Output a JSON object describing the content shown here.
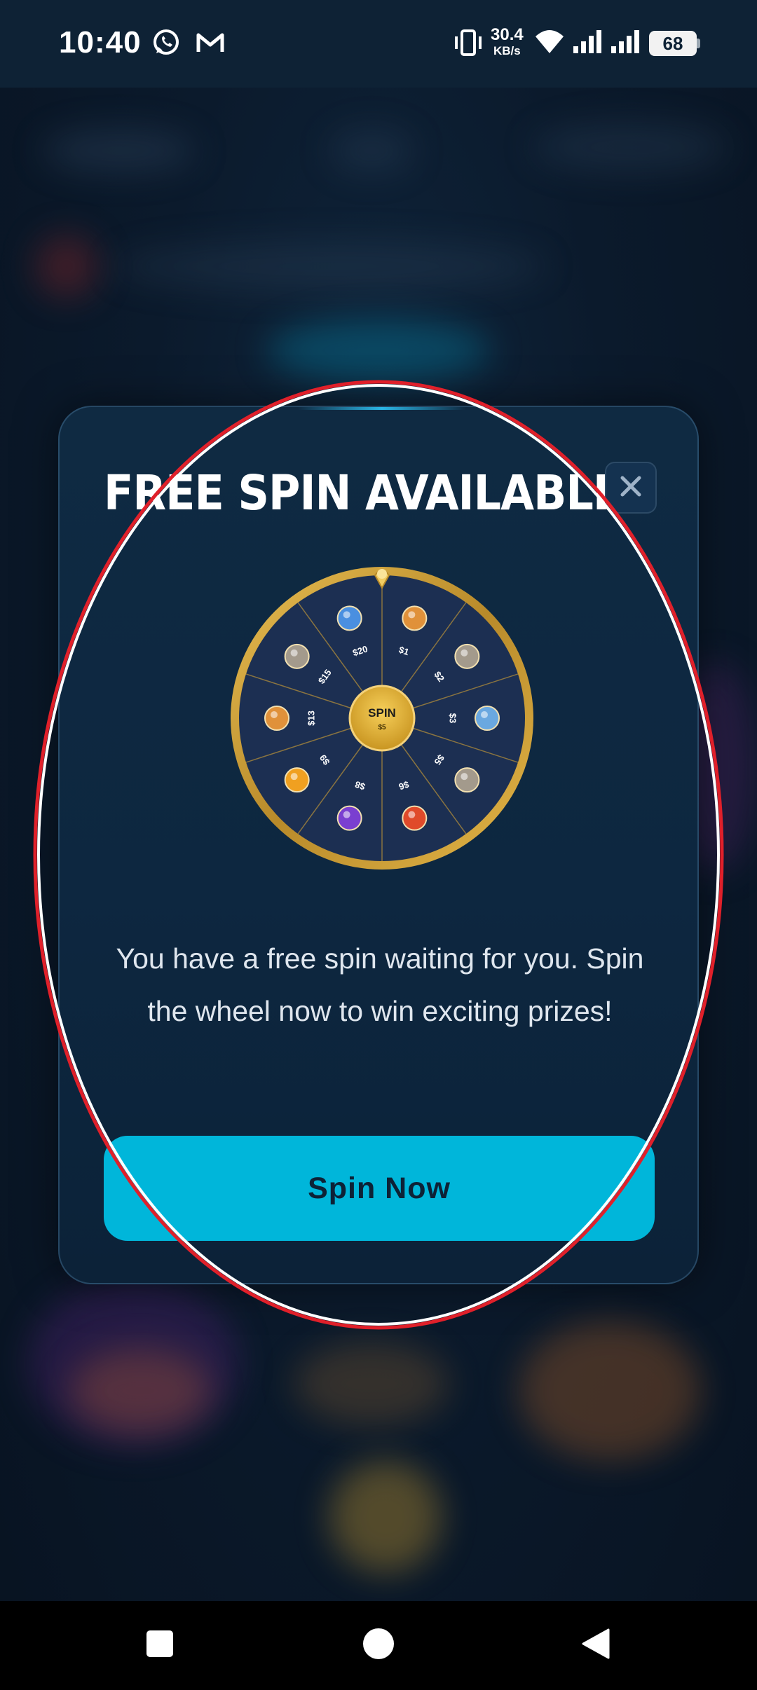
{
  "status_bar": {
    "time": "10:40",
    "net_speed_value": "30.4",
    "net_speed_unit": "KB/s",
    "battery": "68",
    "icons": [
      "whatsapp-icon",
      "gmail-icon",
      "vibrate-icon",
      "wifi-icon",
      "signal-icon",
      "signal-icon",
      "battery-icon"
    ]
  },
  "modal": {
    "title": "FREE SPIN AVAILABLE!",
    "close_icon": "close-icon",
    "wheel": {
      "center_label": "SPIN",
      "center_sublabel": "$5",
      "segments": [
        {
          "label": "$1",
          "icon": "coin-bag-icon"
        },
        {
          "label": "$2",
          "icon": "raccoon-icon"
        },
        {
          "label": "$3",
          "icon": "bottle-icon"
        },
        {
          "label": "$5",
          "icon": "raccoon-icon"
        },
        {
          "label": "$6",
          "icon": "fire-cup-icon"
        },
        {
          "label": "$8",
          "icon": "purple-character-icon"
        },
        {
          "label": "$9",
          "icon": "flower-icon"
        },
        {
          "label": "$13",
          "icon": "coin-bag-icon"
        },
        {
          "label": "$15",
          "icon": "raccoon-icon"
        },
        {
          "label": "$20",
          "icon": "blue-bag-icon"
        }
      ]
    },
    "message": "You have a free spin waiting for you. Spin the wheel now to win exciting prizes!",
    "spin_button": "Spin Now"
  },
  "colors": {
    "accent": "#00b6da",
    "modal_bg": "#0f2a42",
    "wheel_gold": "#d8a838",
    "wheel_segment": "#1c2f52",
    "annotation_red": "#e0202a"
  },
  "nav_bar": {
    "icons": [
      "recents-square-icon",
      "home-circle-icon",
      "back-triangle-icon"
    ]
  }
}
